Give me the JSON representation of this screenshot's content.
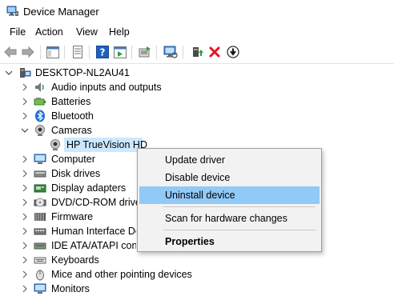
{
  "window": {
    "title": "Device Manager",
    "app_icon": "device-manager-icon"
  },
  "menu": {
    "items": [
      "File",
      "Action",
      "View",
      "Help"
    ]
  },
  "toolbar": {
    "buttons": [
      "back-arrow-icon",
      "forward-arrow-icon",
      "show-hide-console-tree-icon",
      "properties-icon",
      "help-icon",
      "action-pane-icon",
      "update-driver-icon",
      "scan-hardware-icon",
      "enable-device-icon",
      "uninstall-device-icon",
      "disable-device-icon"
    ]
  },
  "tree": {
    "root": "DESKTOP-NL2AU41",
    "categories": [
      {
        "label": "Audio inputs and outputs",
        "icon": "speaker-icon",
        "expanded": false
      },
      {
        "label": "Batteries",
        "icon": "battery-icon",
        "expanded": false
      },
      {
        "label": "Bluetooth",
        "icon": "bluetooth-icon",
        "expanded": false
      },
      {
        "label": "Cameras",
        "icon": "camera-icon",
        "expanded": true
      },
      {
        "label": "Computer",
        "icon": "computer-icon",
        "expanded": false
      },
      {
        "label": "Disk drives",
        "icon": "disk-drive-icon",
        "expanded": false
      },
      {
        "label": "Display adapters",
        "icon": "display-adapter-icon",
        "expanded": false
      },
      {
        "label": "DVD/CD-ROM drives",
        "icon": "dvd-drive-icon",
        "expanded": false
      },
      {
        "label": "Firmware",
        "icon": "firmware-icon",
        "expanded": false
      },
      {
        "label": "Human Interface Devices",
        "icon": "hid-icon",
        "expanded": false
      },
      {
        "label": "IDE ATA/ATAPI controllers",
        "icon": "ide-controller-icon",
        "expanded": false
      },
      {
        "label": "Keyboards",
        "icon": "keyboard-icon",
        "expanded": false
      },
      {
        "label": "Mice and other pointing devices",
        "icon": "mouse-icon",
        "expanded": false
      },
      {
        "label": "Monitors",
        "icon": "monitor-icon",
        "expanded": false
      }
    ],
    "selected_child": {
      "label": "HP TrueVision HD",
      "icon": "webcam-icon"
    }
  },
  "context_menu": {
    "items": [
      {
        "label": "Update driver"
      },
      {
        "label": "Disable device"
      },
      {
        "label": "Uninstall device",
        "highlighted": true
      },
      {
        "label": "Scan for hardware changes"
      },
      {
        "label": "Properties",
        "bold": true
      }
    ]
  },
  "colors": {
    "selection": "#cce8ff",
    "menu_hover": "#91c9f7",
    "menu_bg": "#f2f2f2",
    "uninstall_red": "#e81123",
    "help_blue": "#1f5fbf"
  }
}
